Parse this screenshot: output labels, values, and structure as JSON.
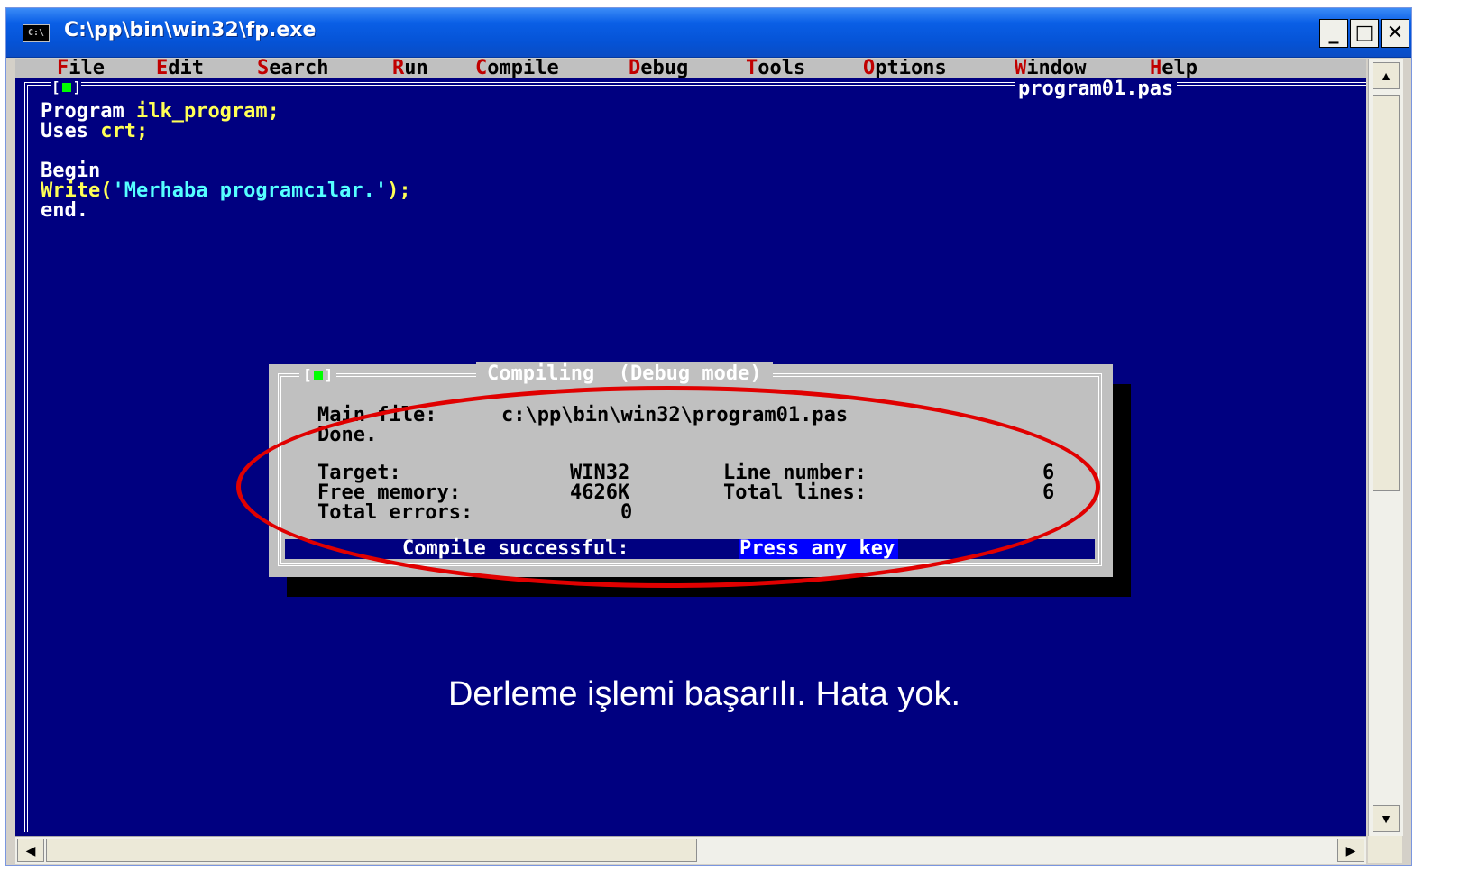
{
  "window": {
    "title": "C:\\pp\\bin\\win32\\fp.exe",
    "icon_label": "C:\\",
    "controls": {
      "minimize": "_",
      "maximize": "□",
      "close": "✕"
    }
  },
  "menu": [
    {
      "hotkey": "F",
      "rest": "ile"
    },
    {
      "hotkey": "E",
      "rest": "dit"
    },
    {
      "hotkey": "S",
      "rest": "earch"
    },
    {
      "hotkey": "R",
      "rest": "un"
    },
    {
      "hotkey": "C",
      "rest": "ompile"
    },
    {
      "hotkey": "D",
      "rest": "ebug"
    },
    {
      "hotkey": "T",
      "rest": "ools"
    },
    {
      "hotkey": "O",
      "rest": "ptions"
    },
    {
      "hotkey": "W",
      "rest": "indow"
    },
    {
      "hotkey": "H",
      "rest": "elp"
    }
  ],
  "editor": {
    "file_name": "program01.pas",
    "close_box": "[■]",
    "code": [
      {
        "kw": "Program ",
        "rest": "ilk_program;"
      },
      {
        "kw": "Uses ",
        "rest": "crt;"
      },
      {
        "kw": "",
        "rest": ""
      },
      {
        "kw": "Begin",
        "rest": ""
      },
      {
        "kw": "Write(",
        "str": "'Merhaba programcılar.'",
        "tail": ");"
      },
      {
        "kw": "end.",
        "rest": ""
      }
    ]
  },
  "dialog": {
    "title": "Compiling  (Debug mode)",
    "main_file_label": "Main file:",
    "main_file_value": "c:\\pp\\bin\\win32\\program01.pas",
    "done": "Done.",
    "target_label": "Target:",
    "target_value": "WIN32",
    "free_memory_label": "Free memory:",
    "free_memory_value": "4626K",
    "total_errors_label": "Total errors:",
    "total_errors_value": "0",
    "line_number_label": "Line number:",
    "line_number_value": "6",
    "total_lines_label": "Total lines:",
    "total_lines_value": "6",
    "status_message": "Compile successful:",
    "status_press": "Press any key"
  },
  "caption": "Derleme işlemi başarılı. Hata yok.",
  "colors": {
    "console_bg": "#000080",
    "menu_bg": "#c0c0c0",
    "hotkey": "#c00000",
    "highlight_ellipse": "#e00000"
  }
}
